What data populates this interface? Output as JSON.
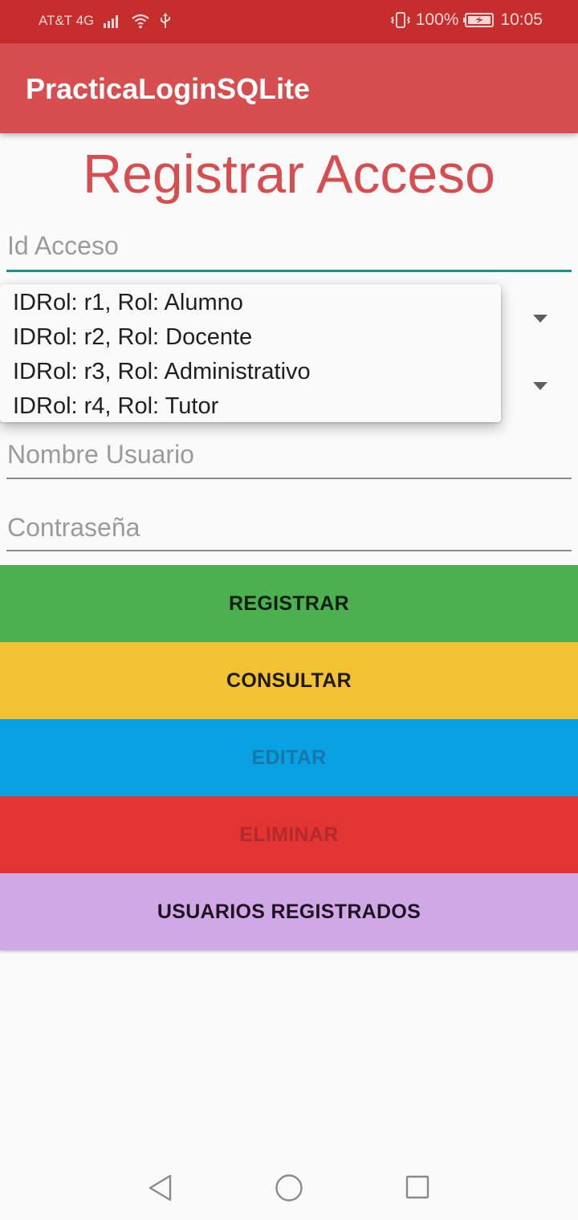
{
  "status_bar": {
    "carrier": "AT&T 4G",
    "battery": "100%",
    "time": "10:05",
    "icons": [
      "signal-icon",
      "wifi-icon",
      "usb-icon",
      "vibrate-icon",
      "battery-icon"
    ]
  },
  "app_bar": {
    "title": "PracticaLoginSQLite"
  },
  "page": {
    "heading": "Registrar Acceso"
  },
  "form": {
    "id_acceso_placeholder": "Id Acceso",
    "nombre_usuario_placeholder": "Nombre Usuario",
    "contrasena_placeholder": "Contraseña"
  },
  "dropdown": {
    "items": [
      "IDRol: r1, Rol: Alumno",
      "IDRol: r2, Rol: Docente",
      "IDRol: r3, Rol: Administrativo",
      "IDRol: r4, Rol: Tutor"
    ]
  },
  "buttons": {
    "registrar": "REGISTRAR",
    "consultar": "CONSULTAR",
    "editar": "EDITAR",
    "eliminar": "ELIMINAR",
    "usuarios": "USUARIOS REGISTRADOS"
  },
  "colors": {
    "status_bar": "#c62d2d",
    "app_bar": "#d64e4f",
    "accent": "#1a9488",
    "registrar": "#4caf50",
    "consultar": "#f2c232",
    "editar": "#0aa1e3",
    "eliminar": "#e33434",
    "usuarios": "#d1a8e6"
  }
}
